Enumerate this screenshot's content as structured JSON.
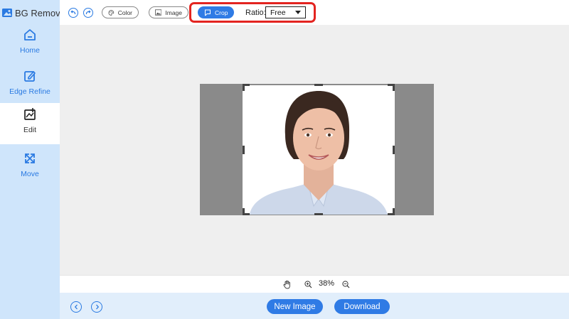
{
  "app": {
    "title": "BG Remover",
    "logo_icon": "image-logo-icon"
  },
  "sidebar": {
    "items": [
      {
        "label": "Home",
        "icon": "home-icon",
        "active": false
      },
      {
        "label": "Edge Refine",
        "icon": "pencil-edit-icon",
        "active": false
      },
      {
        "label": "Edit",
        "icon": "crop-edit-icon",
        "active": true
      },
      {
        "label": "Move",
        "icon": "move-arrows-icon",
        "active": false
      }
    ]
  },
  "toolbar": {
    "color_label": "Color",
    "image_label": "Image",
    "crop_label": "Crop",
    "ratio_label": "Ratio:",
    "ratio_value": "Free"
  },
  "zoom": {
    "value": "38%"
  },
  "footer": {
    "new_image_label": "New Image",
    "download_label": "Download"
  },
  "colors": {
    "accent": "#2f7be5",
    "sidebar_bg": "#cfe5fb",
    "highlight": "#e32420"
  }
}
